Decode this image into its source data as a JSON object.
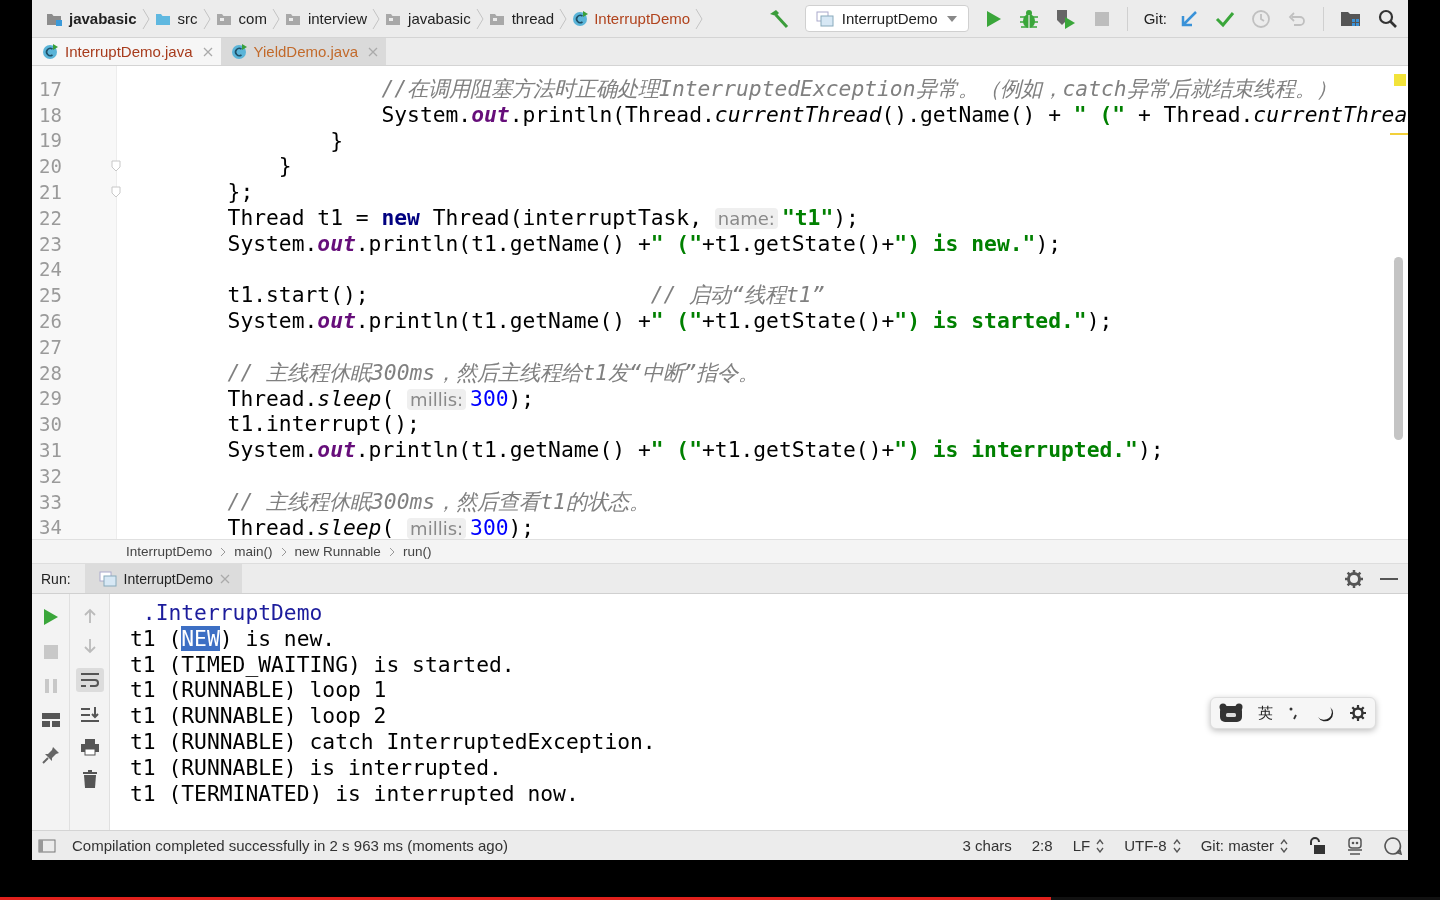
{
  "navbar": {
    "breadcrumbs": [
      {
        "label": "javabasic",
        "kind": "module"
      },
      {
        "label": "src",
        "kind": "source"
      },
      {
        "label": "com",
        "kind": "package"
      },
      {
        "label": "interview",
        "kind": "package"
      },
      {
        "label": "javabasic",
        "kind": "package"
      },
      {
        "label": "thread",
        "kind": "package"
      },
      {
        "label": "InterruptDemo",
        "kind": "class"
      }
    ],
    "run_config": "InterruptDemo",
    "git_label": "Git:"
  },
  "tabs": [
    {
      "label": "InterruptDemo.java",
      "selected": true
    },
    {
      "label": "YieldDemo.java",
      "selected": false
    }
  ],
  "editor": {
    "lines": [
      {
        "number": "17",
        "fold_marker": false,
        "tokens": [
          {
            "kind": "comment",
            "text": "                    //在调用阻塞方法时正确处理InterruptedException异常。（例如，catch异常后就结束线程。）"
          }
        ]
      },
      {
        "number": "18",
        "fold_marker": false,
        "tokens": [
          {
            "kind": "plain",
            "text": "                    System."
          },
          {
            "kind": "field",
            "text": "out"
          },
          {
            "kind": "plain",
            "text": ".println(Thread."
          },
          {
            "kind": "static",
            "text": "currentThread"
          },
          {
            "kind": "plain",
            "text": "().getName() + "
          },
          {
            "kind": "string",
            "text": "\" (\""
          },
          {
            "kind": "plain",
            "text": " + Thread."
          },
          {
            "kind": "static",
            "text": "currentThrea"
          }
        ]
      },
      {
        "number": "19",
        "fold_marker": false,
        "tokens": [
          {
            "kind": "plain",
            "text": "                }"
          }
        ]
      },
      {
        "number": "20",
        "fold_marker": true,
        "tokens": [
          {
            "kind": "plain",
            "text": "            }"
          }
        ]
      },
      {
        "number": "21",
        "fold_marker": true,
        "tokens": [
          {
            "kind": "plain",
            "text": "        };"
          }
        ]
      },
      {
        "number": "22",
        "fold_marker": false,
        "tokens": [
          {
            "kind": "plain",
            "text": "        Thread t1 = "
          },
          {
            "kind": "keyword",
            "text": "new"
          },
          {
            "kind": "plain",
            "text": " Thread(interruptTask, "
          },
          {
            "kind": "hint",
            "text": "name:"
          },
          {
            "kind": "string",
            "text": "\"t1\""
          },
          {
            "kind": "plain",
            "text": ");"
          }
        ]
      },
      {
        "number": "23",
        "fold_marker": false,
        "tokens": [
          {
            "kind": "plain",
            "text": "        System."
          },
          {
            "kind": "field",
            "text": "out"
          },
          {
            "kind": "plain",
            "text": ".println(t1.getName() +"
          },
          {
            "kind": "string",
            "text": "\" (\""
          },
          {
            "kind": "plain",
            "text": "+t1.getState()+"
          },
          {
            "kind": "string",
            "text": "\") is new.\""
          },
          {
            "kind": "plain",
            "text": ");"
          }
        ]
      },
      {
        "number": "24",
        "fold_marker": false
      },
      {
        "number": "25",
        "fold_marker": false,
        "tokens": [
          {
            "kind": "plain",
            "text": "        t1.start();                      "
          },
          {
            "kind": "comment",
            "text": "// 启动“线程t1”"
          }
        ]
      },
      {
        "number": "26",
        "fold_marker": false,
        "tokens": [
          {
            "kind": "plain",
            "text": "        System."
          },
          {
            "kind": "field",
            "text": "out"
          },
          {
            "kind": "plain",
            "text": ".println(t1.getName() +"
          },
          {
            "kind": "string",
            "text": "\" (\""
          },
          {
            "kind": "plain",
            "text": "+t1.getState()+"
          },
          {
            "kind": "string",
            "text": "\") is started.\""
          },
          {
            "kind": "plain",
            "text": ");"
          }
        ]
      },
      {
        "number": "27",
        "fold_marker": false
      },
      {
        "number": "28",
        "fold_marker": false,
        "tokens": [
          {
            "kind": "comment",
            "text": "        // 主线程休眠300ms，然后主线程给t1发“中断”指令。"
          }
        ]
      },
      {
        "number": "29",
        "fold_marker": false,
        "tokens": [
          {
            "kind": "plain",
            "text": "        Thread."
          },
          {
            "kind": "static",
            "text": "sleep"
          },
          {
            "kind": "plain",
            "text": "( "
          },
          {
            "kind": "hint",
            "text": "millis:"
          },
          {
            "kind": "number",
            "text": "300"
          },
          {
            "kind": "plain",
            "text": ");"
          }
        ]
      },
      {
        "number": "30",
        "fold_marker": false,
        "tokens": [
          {
            "kind": "plain",
            "text": "        t1.interrupt();"
          }
        ]
      },
      {
        "number": "31",
        "fold_marker": false,
        "tokens": [
          {
            "kind": "plain",
            "text": "        System."
          },
          {
            "kind": "field",
            "text": "out"
          },
          {
            "kind": "plain",
            "text": ".println(t1.getName() +"
          },
          {
            "kind": "string",
            "text": "\" (\""
          },
          {
            "kind": "plain",
            "text": "+t1.getState()+"
          },
          {
            "kind": "string",
            "text": "\") is interrupted.\""
          },
          {
            "kind": "plain",
            "text": ");"
          }
        ]
      },
      {
        "number": "32",
        "fold_marker": false
      },
      {
        "number": "33",
        "fold_marker": false,
        "tokens": [
          {
            "kind": "comment",
            "text": "        // 主线程休眠300ms，然后查看t1的状态。"
          }
        ]
      },
      {
        "number": "34",
        "fold_marker": false,
        "tokens": [
          {
            "kind": "plain",
            "text": "        Thread."
          },
          {
            "kind": "static",
            "text": "sleep"
          },
          {
            "kind": "plain",
            "text": "( "
          },
          {
            "kind": "hint",
            "text": "millis:"
          },
          {
            "kind": "number",
            "text": "300"
          },
          {
            "kind": "plain",
            "text": ");"
          }
        ]
      }
    ]
  },
  "code_path": [
    "InterruptDemo",
    "main()",
    "new Runnable",
    "run()"
  ],
  "run_panel": {
    "label": "Run:",
    "tab": "InterruptDemo",
    "output": [
      {
        "kind": "classname",
        "segments": [
          {
            "text": " .InterruptDemo",
            "selected": false
          }
        ]
      },
      {
        "kind": "stdout",
        "segments": [
          {
            "text": "t1 (",
            "selected": false
          },
          {
            "text": "NEW",
            "selected": true
          },
          {
            "text": ") is new.",
            "selected": false
          }
        ]
      },
      {
        "kind": "stdout",
        "segments": [
          {
            "text": "t1 (TIMED_WAITING) is started.",
            "selected": false
          }
        ]
      },
      {
        "kind": "stdout",
        "segments": [
          {
            "text": "t1 (RUNNABLE) loop 1",
            "selected": false
          }
        ]
      },
      {
        "kind": "stdout",
        "segments": [
          {
            "text": "t1 (RUNNABLE) loop 2",
            "selected": false
          }
        ]
      },
      {
        "kind": "stdout",
        "segments": [
          {
            "text": "t1 (RUNNABLE) catch InterruptedException.",
            "selected": false
          }
        ]
      },
      {
        "kind": "stdout",
        "segments": [
          {
            "text": "t1 (RUNNABLE) is interrupted.",
            "selected": false
          }
        ]
      },
      {
        "kind": "stdout",
        "segments": [
          {
            "text": "t1 (TERMINATED) is interrupted now.",
            "selected": false
          }
        ]
      }
    ]
  },
  "ime_toolbar": {
    "mode": "英"
  },
  "status_bar": {
    "message": "Compilation completed successfully in 2 s 963 ms (moments ago)",
    "selection": "3 chars",
    "position": "2:8",
    "line_separator": "LF",
    "encoding": "UTF-8",
    "vcs_branch": "Git: master"
  },
  "video_progress": {
    "level": 0.73
  }
}
